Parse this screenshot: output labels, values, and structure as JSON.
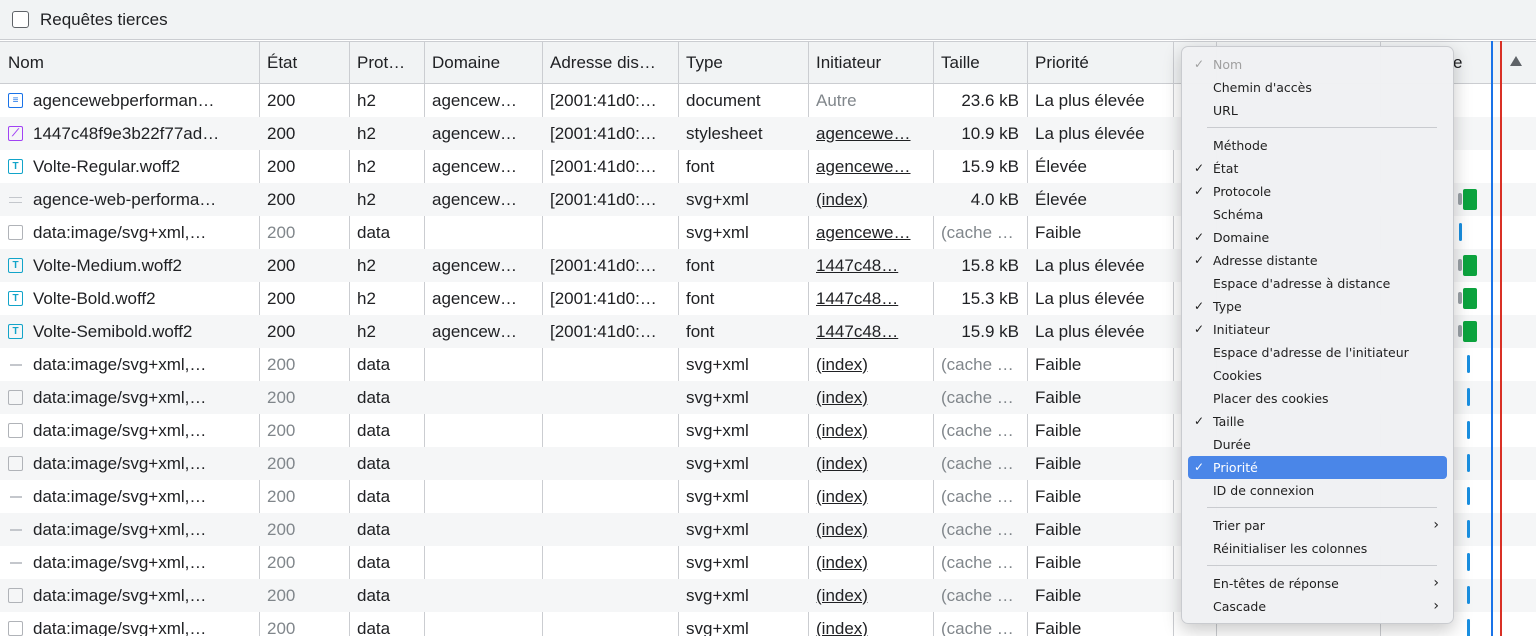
{
  "topbar": {
    "checkbox_label": "Requêtes tierces",
    "checked": false
  },
  "columns": [
    "Nom",
    "État",
    "Prot…",
    "Domaine",
    "Adresse dis…",
    "Type",
    "Initiateur",
    "Taille",
    "Priorité"
  ],
  "waterfall_header": "e",
  "rows": [
    {
      "icon": "document-icon",
      "name": "agencewebperforman…",
      "status": "200",
      "protocol": "h2",
      "domain": "agencew…",
      "address": "[2001:41d0:…",
      "type": "document",
      "initiator": "Autre",
      "size": "23.6 kB",
      "priority": "La plus élevée",
      "wf": "none"
    },
    {
      "icon": "stylesheet-icon",
      "name": "1447c48f9e3b22f77ad…",
      "status": "200",
      "protocol": "h2",
      "domain": "agencew…",
      "address": "[2001:41d0:…",
      "type": "stylesheet",
      "initiator": "agencewe…",
      "size": "10.9 kB",
      "priority": "La plus élevée",
      "wf": "none"
    },
    {
      "icon": "font-icon",
      "name": "Volte-Regular.woff2",
      "status": "200",
      "protocol": "h2",
      "domain": "agencew…",
      "address": "[2001:41d0:…",
      "type": "font",
      "initiator": "agencewe…",
      "size": "15.9 kB",
      "priority": "Élevée",
      "wf": "none"
    },
    {
      "icon": "image-dots-icon",
      "name": "agence-web-performa…",
      "status": "200",
      "protocol": "h2",
      "domain": "agencew…",
      "address": "[2001:41d0:…",
      "type": "svg+xml",
      "initiator": "(index)",
      "size": "4.0 kB",
      "priority": "Élevée",
      "wf": "green"
    },
    {
      "icon": "image-icon",
      "name": "data:image/svg+xml,…",
      "status": "200",
      "protocol": "data",
      "domain": "",
      "address": "",
      "type": "svg+xml",
      "initiator": "agencewe…",
      "size": "(cache …",
      "priority": "Faible",
      "wf": "blue"
    },
    {
      "icon": "font-icon",
      "name": "Volte-Medium.woff2",
      "status": "200",
      "protocol": "h2",
      "domain": "agencew…",
      "address": "[2001:41d0:…",
      "type": "font",
      "initiator": "1447c48…",
      "size": "15.8 kB",
      "priority": "La plus élevée",
      "wf": "green"
    },
    {
      "icon": "font-icon",
      "name": "Volte-Bold.woff2",
      "status": "200",
      "protocol": "h2",
      "domain": "agencew…",
      "address": "[2001:41d0:…",
      "type": "font",
      "initiator": "1447c48…",
      "size": "15.3 kB",
      "priority": "La plus élevée",
      "wf": "green"
    },
    {
      "icon": "font-icon",
      "name": "Volte-Semibold.woff2",
      "status": "200",
      "protocol": "h2",
      "domain": "agencew…",
      "address": "[2001:41d0:…",
      "type": "font",
      "initiator": "1447c48…",
      "size": "15.9 kB",
      "priority": "La plus élevée",
      "wf": "green"
    },
    {
      "icon": "dash-icon",
      "name": "data:image/svg+xml,…",
      "status": "200",
      "protocol": "data",
      "domain": "",
      "address": "",
      "type": "svg+xml",
      "initiator": "(index)",
      "size": "(cache …",
      "priority": "Faible",
      "wf": "blue"
    },
    {
      "icon": "image-icon",
      "name": "data:image/svg+xml,…",
      "status": "200",
      "protocol": "data",
      "domain": "",
      "address": "",
      "type": "svg+xml",
      "initiator": "(index)",
      "size": "(cache …",
      "priority": "Faible",
      "wf": "blue"
    },
    {
      "icon": "image-icon",
      "name": "data:image/svg+xml,…",
      "status": "200",
      "protocol": "data",
      "domain": "",
      "address": "",
      "type": "svg+xml",
      "initiator": "(index)",
      "size": "(cache …",
      "priority": "Faible",
      "wf": "blue"
    },
    {
      "icon": "image-icon",
      "name": "data:image/svg+xml,…",
      "status": "200",
      "protocol": "data",
      "domain": "",
      "address": "",
      "type": "svg+xml",
      "initiator": "(index)",
      "size": "(cache …",
      "priority": "Faible",
      "wf": "blue"
    },
    {
      "icon": "dash-icon",
      "name": "data:image/svg+xml,…",
      "status": "200",
      "protocol": "data",
      "domain": "",
      "address": "",
      "type": "svg+xml",
      "initiator": "(index)",
      "size": "(cache …",
      "priority": "Faible",
      "wf": "blue"
    },
    {
      "icon": "dash-icon",
      "name": "data:image/svg+xml,…",
      "status": "200",
      "protocol": "data",
      "domain": "",
      "address": "",
      "type": "svg+xml",
      "initiator": "(index)",
      "size": "(cache …",
      "priority": "Faible",
      "wf": "blue"
    },
    {
      "icon": "dash-icon",
      "name": "data:image/svg+xml,…",
      "status": "200",
      "protocol": "data",
      "domain": "",
      "address": "",
      "type": "svg+xml",
      "initiator": "(index)",
      "size": "(cache …",
      "priority": "Faible",
      "wf": "blue"
    },
    {
      "icon": "image-icon",
      "name": "data:image/svg+xml,…",
      "status": "200",
      "protocol": "data",
      "domain": "",
      "address": "",
      "type": "svg+xml",
      "initiator": "(index)",
      "size": "(cache …",
      "priority": "Faible",
      "wf": "blue"
    },
    {
      "icon": "image-icon",
      "name": "data:image/svg+xml,…",
      "status": "200",
      "protocol": "data",
      "domain": "",
      "address": "",
      "type": "svg+xml",
      "initiator": "(index)",
      "size": "(cache …",
      "priority": "Faible",
      "wf": "blue"
    }
  ],
  "context_menu": {
    "items": [
      {
        "label": "Nom",
        "checked": true,
        "disabled": true
      },
      {
        "label": "Chemin d'accès",
        "checked": false
      },
      {
        "label": "URL",
        "checked": false
      },
      {
        "separator": true
      },
      {
        "label": "Méthode",
        "checked": false
      },
      {
        "label": "État",
        "checked": true
      },
      {
        "label": "Protocole",
        "checked": true
      },
      {
        "label": "Schéma",
        "checked": false
      },
      {
        "label": "Domaine",
        "checked": true
      },
      {
        "label": "Adresse distante",
        "checked": true
      },
      {
        "label": "Espace d'adresse à distance",
        "checked": false
      },
      {
        "label": "Type",
        "checked": true
      },
      {
        "label": "Initiateur",
        "checked": true
      },
      {
        "label": "Espace d'adresse de l'initiateur",
        "checked": false
      },
      {
        "label": "Cookies",
        "checked": false
      },
      {
        "label": "Placer des cookies",
        "checked": false
      },
      {
        "label": "Taille",
        "checked": true
      },
      {
        "label": "Durée",
        "checked": false
      },
      {
        "label": "Priorité",
        "checked": true,
        "active": true
      },
      {
        "label": "ID de connexion",
        "checked": false
      },
      {
        "separator": true
      },
      {
        "label": "Trier par",
        "checked": false,
        "submenu": true
      },
      {
        "label": "Réinitialiser les colonnes",
        "checked": false
      },
      {
        "separator": true
      },
      {
        "label": "En-têtes de réponse",
        "checked": false,
        "submenu": true
      },
      {
        "label": "Cascade",
        "checked": false,
        "submenu": true
      }
    ]
  },
  "colors": {
    "accent": "#4a86e8",
    "green_bar": "#0ca33e",
    "blue_line": "#1a73e8",
    "red_line": "#d93025"
  }
}
